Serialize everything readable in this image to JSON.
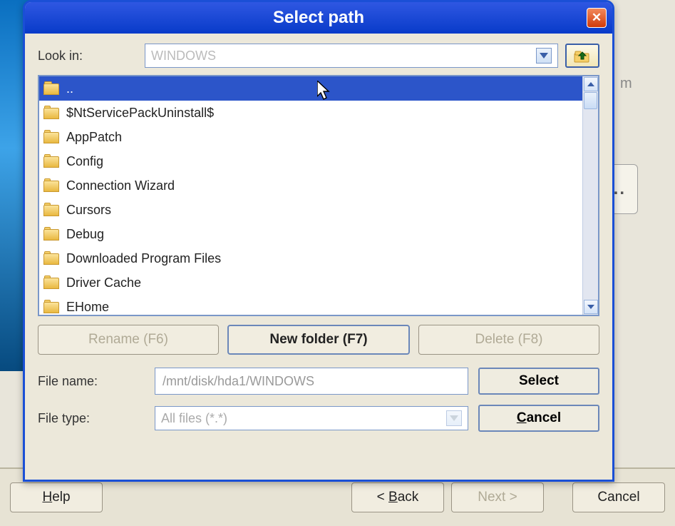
{
  "dialog": {
    "title": "Select path",
    "lookin_label": "Look in:",
    "lookin_value": "WINDOWS",
    "items": [
      {
        "name": "..",
        "selected": true
      },
      {
        "name": "$NtServicePackUninstall$"
      },
      {
        "name": "AppPatch"
      },
      {
        "name": "Config"
      },
      {
        "name": "Connection Wizard"
      },
      {
        "name": "Cursors"
      },
      {
        "name": "Debug"
      },
      {
        "name": "Downloaded Program Files"
      },
      {
        "name": "Driver Cache"
      },
      {
        "name": "EHome"
      }
    ],
    "btn_rename": "Rename (F6)",
    "btn_newfolder": "New folder (F7)",
    "btn_delete": "Delete (F8)",
    "filename_label": "File name:",
    "filename_value": "/mnt/disk/hda1/WINDOWS",
    "filetype_label": "File type:",
    "filetype_value": "All files (*.*)",
    "btn_select": "Select",
    "btn_cancel": "Cancel"
  },
  "wizard": {
    "help": "Help",
    "back": "< Back",
    "next": "Next >",
    "cancel": "Cancel"
  },
  "misc": {
    "bg_letter": "m",
    "ellipsis": "..."
  }
}
